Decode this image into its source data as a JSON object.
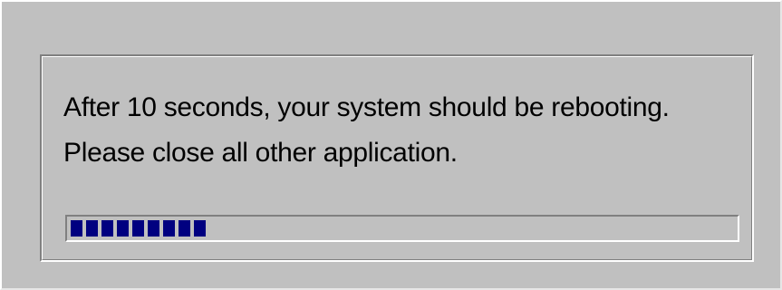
{
  "dialog": {
    "message_line1": "After 10 seconds, your system should be rebooting.",
    "message_line2": "Please close all other application.",
    "progress": {
      "fraction": 0.2,
      "segments": 8,
      "bar_color": "#000080"
    }
  },
  "colors": {
    "face": "#c0c0c0",
    "highlight": "#ffffff",
    "shadow": "#808080"
  }
}
